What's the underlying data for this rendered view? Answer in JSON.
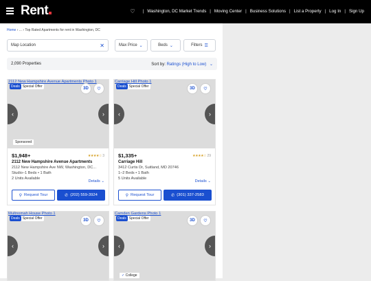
{
  "header": {
    "logo": "Rent",
    "nav": [
      "Washington, DC Market Trends",
      "Moving Center",
      "Business Solutions",
      "List a Property",
      "Log In",
      "Sign Up"
    ]
  },
  "breadcrumb": {
    "home": "Home",
    "ellipsis": "...",
    "current": "Top Rated Apartments for rent in Washington, DC"
  },
  "filters": {
    "location_placeholder": "Map Location",
    "max_price": "Max Price",
    "beds": "Beds",
    "filters": "Filters"
  },
  "results": {
    "count": "2,090 Properties",
    "sort_label": "Sort by:",
    "sort_value": "Ratings (High to Low)"
  },
  "colors": {
    "accent": "#1a4fd0",
    "header_bg": "#000000"
  },
  "listings": [
    {
      "alt": "2112 New Hampshire Avenue Apartments Photo 1",
      "badge_deals": "Deals",
      "badge_offer": "Special Offer",
      "tour3d": "3D",
      "price": "$1,948+",
      "stars": "★★★★☆",
      "rating_count": "3",
      "name": "2112 New Hampshire Avenue Apartments",
      "address": "2112 New Hampshire Ave NW, Washington, DC...",
      "beds": "Studio–1 Beds • 1 Bath",
      "units": "2 Units Available",
      "details": "Details",
      "tour": "Request Tour",
      "phone": "(202) 559-3924",
      "tag": "Sponsored"
    },
    {
      "alt": "Carriage Hill Photo 1",
      "badge_deals": "Deals",
      "badge_offer": "Special Offer",
      "tour3d": "3D",
      "price": "$1,335+",
      "stars": "★★★★☆",
      "rating_count": "29",
      "name": "Carriage Hill",
      "address": "3412 Curtis Dr, Suitland, MD 20746",
      "beds": "1–2 Beds • 1 Bath",
      "units": "5 Units Available",
      "details": "Details",
      "tour": "Request Tour",
      "phone": "(301) 337-2583"
    },
    {
      "alt": "Multnomah House Photo 1",
      "badge_deals": "Deals",
      "badge_offer": "Special Offer",
      "tour3d": "3D"
    },
    {
      "alt": "Camden Gardens Photo 1",
      "badge_deals": "Deals",
      "badge_offer": "Special Offer",
      "tour3d": "3D",
      "tag": "College"
    }
  ]
}
